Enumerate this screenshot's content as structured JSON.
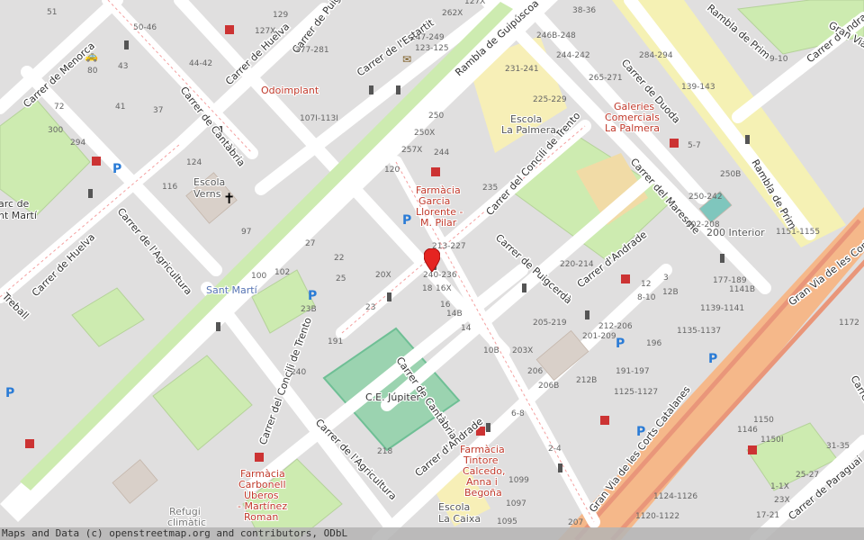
{
  "map": {
    "attribution": "Maps and Data (c) openstreetmap.org and contributors, ODbL",
    "marker": {
      "label": "location-marker"
    },
    "streets": [
      {
        "id": "s1",
        "label": "Carrer de Menorca"
      },
      {
        "id": "s2",
        "label": "Carrer de Cantàbria"
      },
      {
        "id": "s3",
        "label": "Carrer de Huelva"
      },
      {
        "id": "s4",
        "label": "Carrer de Puigcerdà"
      },
      {
        "id": "s5",
        "label": "Carrer de l'Estartit"
      },
      {
        "id": "s6",
        "label": "Rambla de Guipúscoa"
      },
      {
        "id": "s7",
        "label": "Carrer de Duoda"
      },
      {
        "id": "s8",
        "label": "Rambla de Prim"
      },
      {
        "id": "s9",
        "label": "Carrer d'Andrade"
      },
      {
        "id": "s10",
        "label": "Carrer de l'Agricultura"
      },
      {
        "id": "s11",
        "label": "Carrer de Huelva"
      },
      {
        "id": "s12",
        "label": "Carrer del Concili de Trento"
      },
      {
        "id": "s13",
        "label": "Carrer del Maresme"
      },
      {
        "id": "s14",
        "label": "Rambla de Prim"
      },
      {
        "id": "s15",
        "label": "Carrer de Puigcerdà"
      },
      {
        "id": "s16",
        "label": "Carrer d'Andrade"
      },
      {
        "id": "s17",
        "label": "Gran Via de les Corts Catalanes"
      },
      {
        "id": "s18",
        "label": "Carrer del Concili de Trento"
      },
      {
        "id": "s19",
        "label": "Carrer de Cantàbria"
      },
      {
        "id": "s20",
        "label": "Carrer de l'Agricultura"
      },
      {
        "id": "s21",
        "label": "Carrer d'Andrade"
      },
      {
        "id": "s22",
        "label": "Gran Via de les Corts Catalanes"
      },
      {
        "id": "s23",
        "label": "Carrer de Paraguai"
      },
      {
        "id": "s24",
        "label": "Gran Via de les Corts Catalanes"
      },
      {
        "id": "s25",
        "label": "Treball"
      },
      {
        "id": "s26",
        "label": "Carrer de la"
      }
    ],
    "places": [
      {
        "id": "p1",
        "label": "Odoimplant"
      },
      {
        "id": "p2",
        "label": "Escola"
      },
      {
        "id": "p3",
        "label": "Verns"
      },
      {
        "id": "p4",
        "label": "Escola"
      },
      {
        "id": "p5",
        "label": "La Palmera"
      },
      {
        "id": "p6",
        "label": "Galeries"
      },
      {
        "id": "p7",
        "label": "Comercials"
      },
      {
        "id": "p8",
        "label": "La Palmera"
      },
      {
        "id": "p9",
        "label": "Farmàcia"
      },
      {
        "id": "p10",
        "label": "Garcia"
      },
      {
        "id": "p11",
        "label": "Llorente -"
      },
      {
        "id": "p12",
        "label": "M. Pilar"
      },
      {
        "id": "p13",
        "label": "Sant Martí"
      },
      {
        "id": "p14",
        "label": "C.E. Júpiter"
      },
      {
        "id": "p15",
        "label": "Farmàcia"
      },
      {
        "id": "p16",
        "label": "Carbonell"
      },
      {
        "id": "p17",
        "label": "Uberos"
      },
      {
        "id": "p18",
        "label": "- Martínez"
      },
      {
        "id": "p19",
        "label": "Roman"
      },
      {
        "id": "p20",
        "label": "Farmàcia"
      },
      {
        "id": "p21",
        "label": "Tintore"
      },
      {
        "id": "p22",
        "label": "Calcedo,"
      },
      {
        "id": "p23",
        "label": "Anna i"
      },
      {
        "id": "p24",
        "label": "Begoña"
      },
      {
        "id": "p25",
        "label": "Escola"
      },
      {
        "id": "p26",
        "label": "La Caixa"
      },
      {
        "id": "p27",
        "label": "Refugi"
      },
      {
        "id": "p28",
        "label": "climàtic"
      },
      {
        "id": "p29",
        "label": "arc de"
      },
      {
        "id": "p30",
        "label": "nt Martí"
      },
      {
        "id": "p31",
        "label": "200 Interior"
      }
    ],
    "numbers": [
      {
        "id": "n1",
        "label": "51"
      },
      {
        "id": "n2",
        "label": "50-46"
      },
      {
        "id": "n3",
        "label": "44-42"
      },
      {
        "id": "n4",
        "label": "43"
      },
      {
        "id": "n5",
        "label": "80"
      },
      {
        "id": "n6",
        "label": "72"
      },
      {
        "id": "n7",
        "label": "41"
      },
      {
        "id": "n8",
        "label": "37"
      },
      {
        "id": "n9",
        "label": "300"
      },
      {
        "id": "n10",
        "label": "294"
      },
      {
        "id": "n11",
        "label": "124"
      },
      {
        "id": "n12",
        "label": "116"
      },
      {
        "id": "n13",
        "label": "129"
      },
      {
        "id": "n14",
        "label": "127X"
      },
      {
        "id": "n15",
        "label": "277-281"
      },
      {
        "id": "n16",
        "label": "107I-113I"
      },
      {
        "id": "n17",
        "label": "247-249"
      },
      {
        "id": "n18",
        "label": "123-125"
      },
      {
        "id": "n19",
        "label": "262X"
      },
      {
        "id": "n20",
        "label": "127X"
      },
      {
        "id": "n21",
        "label": "38-36"
      },
      {
        "id": "n22",
        "label": "246B-248"
      },
      {
        "id": "n23",
        "label": "244-242"
      },
      {
        "id": "n24",
        "label": "231-241"
      },
      {
        "id": "n25",
        "label": "265-271"
      },
      {
        "id": "n26",
        "label": "284-294"
      },
      {
        "id": "n27",
        "label": "225-229"
      },
      {
        "id": "n28",
        "label": "139-143"
      },
      {
        "id": "n29",
        "label": "9-10"
      },
      {
        "id": "n30",
        "label": "250"
      },
      {
        "id": "n31",
        "label": "250X"
      },
      {
        "id": "n32",
        "label": "257X"
      },
      {
        "id": "n33",
        "label": "244"
      },
      {
        "id": "n34",
        "label": "120"
      },
      {
        "id": "n35",
        "label": "235"
      },
      {
        "id": "n36",
        "label": "5-7"
      },
      {
        "id": "n37",
        "label": "250B"
      },
      {
        "id": "n38",
        "label": "250-242"
      },
      {
        "id": "n39",
        "label": "202-208"
      },
      {
        "id": "n40",
        "label": "1151-1155"
      },
      {
        "id": "n41",
        "label": "213-227"
      },
      {
        "id": "n42",
        "label": "240-236"
      },
      {
        "id": "n43",
        "label": "220-214"
      },
      {
        "id": "n44",
        "label": "18"
      },
      {
        "id": "n45",
        "label": "16X"
      },
      {
        "id": "n46",
        "label": "16"
      },
      {
        "id": "n47",
        "label": "14B"
      },
      {
        "id": "n48",
        "label": "14"
      },
      {
        "id": "n49",
        "label": "97"
      },
      {
        "id": "n50",
        "label": "27"
      },
      {
        "id": "n51",
        "label": "22"
      },
      {
        "id": "n52",
        "label": "20X"
      },
      {
        "id": "n53",
        "label": "100"
      },
      {
        "id": "n54",
        "label": "102"
      },
      {
        "id": "n55",
        "label": "25"
      },
      {
        "id": "n56",
        "label": "23B"
      },
      {
        "id": "n57",
        "label": "23"
      },
      {
        "id": "n58",
        "label": "191"
      },
      {
        "id": "n59",
        "label": "240"
      },
      {
        "id": "n60",
        "label": "3"
      },
      {
        "id": "n61",
        "label": "8-10"
      },
      {
        "id": "n62",
        "label": "12B"
      },
      {
        "id": "n63",
        "label": "12"
      },
      {
        "id": "n64",
        "label": "177-189"
      },
      {
        "id": "n65",
        "label": "1141B"
      },
      {
        "id": "n66",
        "label": "1139-1141"
      },
      {
        "id": "n67",
        "label": "205-219"
      },
      {
        "id": "n68",
        "label": "212-206"
      },
      {
        "id": "n69",
        "label": "201-209"
      },
      {
        "id": "n70",
        "label": "196"
      },
      {
        "id": "n71",
        "label": "1135-1137"
      },
      {
        "id": "n72",
        "label": "10B"
      },
      {
        "id": "n73",
        "label": "203X"
      },
      {
        "id": "n74",
        "label": "206"
      },
      {
        "id": "n75",
        "label": "206B"
      },
      {
        "id": "n76",
        "label": "191-197"
      },
      {
        "id": "n77",
        "label": "212B"
      },
      {
        "id": "n78",
        "label": "1125-1127"
      },
      {
        "id": "n79",
        "label": "1172"
      },
      {
        "id": "n80",
        "label": "6-8"
      },
      {
        "id": "n81",
        "label": "2-4"
      },
      {
        "id": "n82",
        "label": "1150"
      },
      {
        "id": "n83",
        "label": "1146"
      },
      {
        "id": "n84",
        "label": "1150I"
      },
      {
        "id": "n85",
        "label": "31-35"
      },
      {
        "id": "n86",
        "label": "25-27"
      },
      {
        "id": "n87",
        "label": "1-1X"
      },
      {
        "id": "n88",
        "label": "23X"
      },
      {
        "id": "n89",
        "label": "218"
      },
      {
        "id": "n90",
        "label": "1099"
      },
      {
        "id": "n91",
        "label": "1095"
      },
      {
        "id": "n92",
        "label": "1124-1126"
      },
      {
        "id": "n93",
        "label": "1120-1122"
      },
      {
        "id": "n94",
        "label": "17-21"
      },
      {
        "id": "n95",
        "label": "207"
      },
      {
        "id": "n96",
        "label": "1097"
      }
    ]
  }
}
